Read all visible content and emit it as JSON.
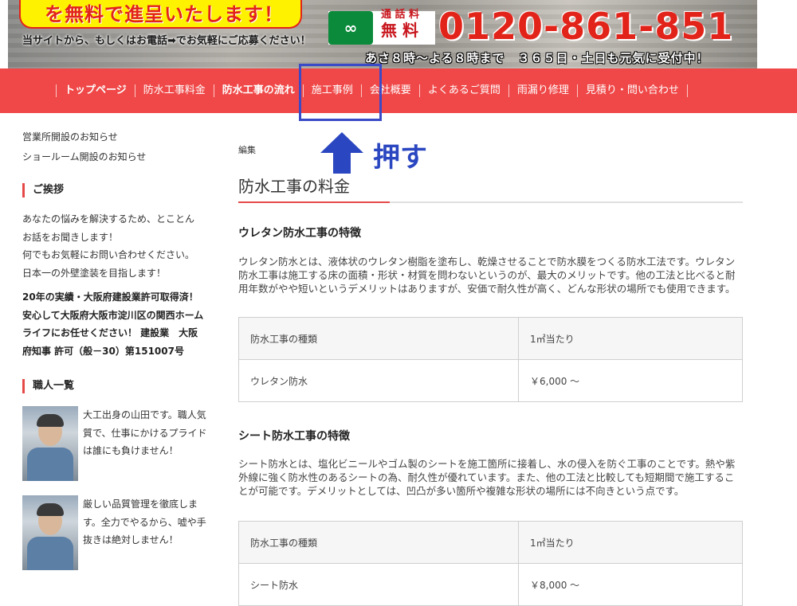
{
  "banner": {
    "promo": "を無料で進呈いたします！",
    "subtitle": "当サイトから、もしくはお電話➡でお気軽にご応募ください！",
    "freedial_icon": "∞",
    "freedial_top": "通 話 料",
    "freedial_bottom": "無 料",
    "phone": "0120-861-851",
    "hours": "あさ８時～よる８時まで　３６５日・土日も元気に受付中！"
  },
  "nav": {
    "items": [
      {
        "label": "トップページ",
        "bold": true
      },
      {
        "label": "防水工事料金",
        "bold": false
      },
      {
        "label": "防水工事の流れ",
        "bold": true
      },
      {
        "label": "施工事例",
        "bold": false
      },
      {
        "label": "会社概要",
        "bold": false
      },
      {
        "label": "よくあるご質問",
        "bold": false
      },
      {
        "label": "雨漏り修理",
        "bold": false
      },
      {
        "label": "見積り・問い合わせ",
        "bold": false
      }
    ]
  },
  "annotation": {
    "push_label": "押す",
    "color": "#2a46c0"
  },
  "sidebar": {
    "links": [
      "営業所開設のお知らせ",
      "ショールーム開設のお知らせ"
    ],
    "greeting_heading": "ご挨拶",
    "greeting_lines": [
      "あなたの悩みを解決するため、とことん",
      "お話をお聞きします！",
      "何でもお気軽にお問い合わせください。",
      "日本一の外壁塗装を目指します！"
    ],
    "license": "20年の実績・大阪府建設業許可取得済！安心して大阪府大阪市淀川区の関西ホームライフにお任せください！ 建設業　大阪府知事 許可（般－30）第151007号",
    "staff_heading": "職人一覧",
    "staff": [
      {
        "text": "大工出身の山田です。職人気質で、仕事にかけるプライドは誰にも負けません！"
      },
      {
        "text": "厳しい品質管理を徹底します。全力でやるから、嘘や手抜きは絶対しません！"
      }
    ]
  },
  "main": {
    "edit_link": "編集",
    "page_title": "防水工事の料金",
    "sections": [
      {
        "heading": "ウレタン防水工事の特徴",
        "text": "ウレタン防水とは、液体状のウレタン樹脂を塗布し、乾燥させることで防水膜をつくる防水工法です。ウレタン防水工事は施工する床の面積・形状・材質を問わないというのが、最大のメリットです。他の工法と比べると耐用年数がやや短いというデメリットはありますが、安価で耐久性が高く、どんな形状の場所でも使用できます。",
        "table": [
          [
            "防水工事の種類",
            "1㎡当たり"
          ],
          [
            "ウレタン防水",
            "￥6,000 ～"
          ]
        ]
      },
      {
        "heading": "シート防水工事の特徴",
        "text": "シート防水とは、塩化ビニールやゴム製のシートを施工箇所に接着し、水の侵入を防ぐ工事のことです。熱や紫外線に強く防水性のあるシートの為、耐久性が優れています。また、他の工法と比較しても短期間で施工することが可能です。デメリットとしては、凹凸が多い箇所や複雑な形状の場所には不向きという点です。",
        "table": [
          [
            "防水工事の種類",
            "1㎡当たり"
          ],
          [
            "シート防水",
            "￥8,000 ～"
          ]
        ]
      }
    ]
  },
  "colors": {
    "nav_bg": "#f04848",
    "accent_red": "#e2231a",
    "highlight": "#3b4bc8"
  }
}
